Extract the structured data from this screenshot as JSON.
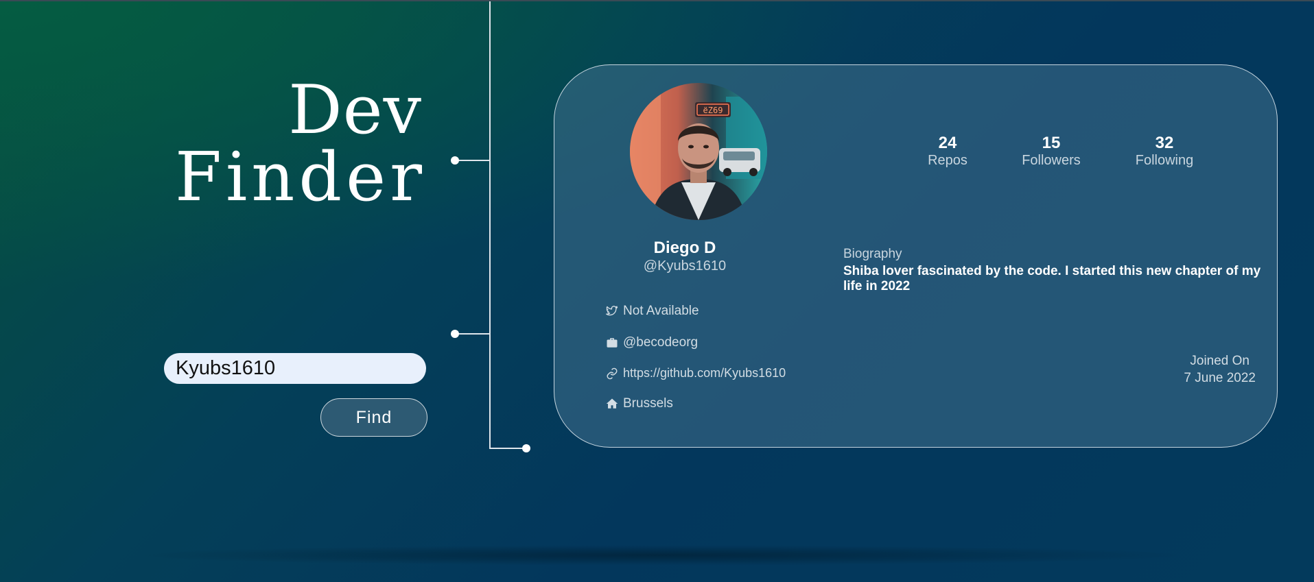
{
  "app": {
    "title_line1": "Dev",
    "title_line2": "Finder"
  },
  "search": {
    "value": "Kyubs1610",
    "button_label": "Find"
  },
  "profile": {
    "name": "Diego D",
    "login": "@Kyubs1610",
    "stats": [
      {
        "value": "24",
        "label": "Repos"
      },
      {
        "value": "15",
        "label": "Followers"
      },
      {
        "value": "32",
        "label": "Following"
      }
    ],
    "biography_label": "Biography",
    "biography": "Shiba lover fascinated by the code. I started this new chapter of my life in 2022",
    "twitter": "Not Available",
    "company": "@becodeorg",
    "blog": "https://github.com/Kyubs1610",
    "location": "Brussels",
    "joined_label": "Joined On",
    "joined_date": "7 June 2022"
  },
  "icons": {
    "twitter": "twitter-icon",
    "company": "briefcase-icon",
    "blog": "link-icon",
    "location": "home-icon"
  },
  "colors": {
    "background_start": "#06503f",
    "background_end": "#03375c",
    "card": "#40708c",
    "input_bg": "#e8f0fc",
    "button_bg": "#2d5a73"
  }
}
